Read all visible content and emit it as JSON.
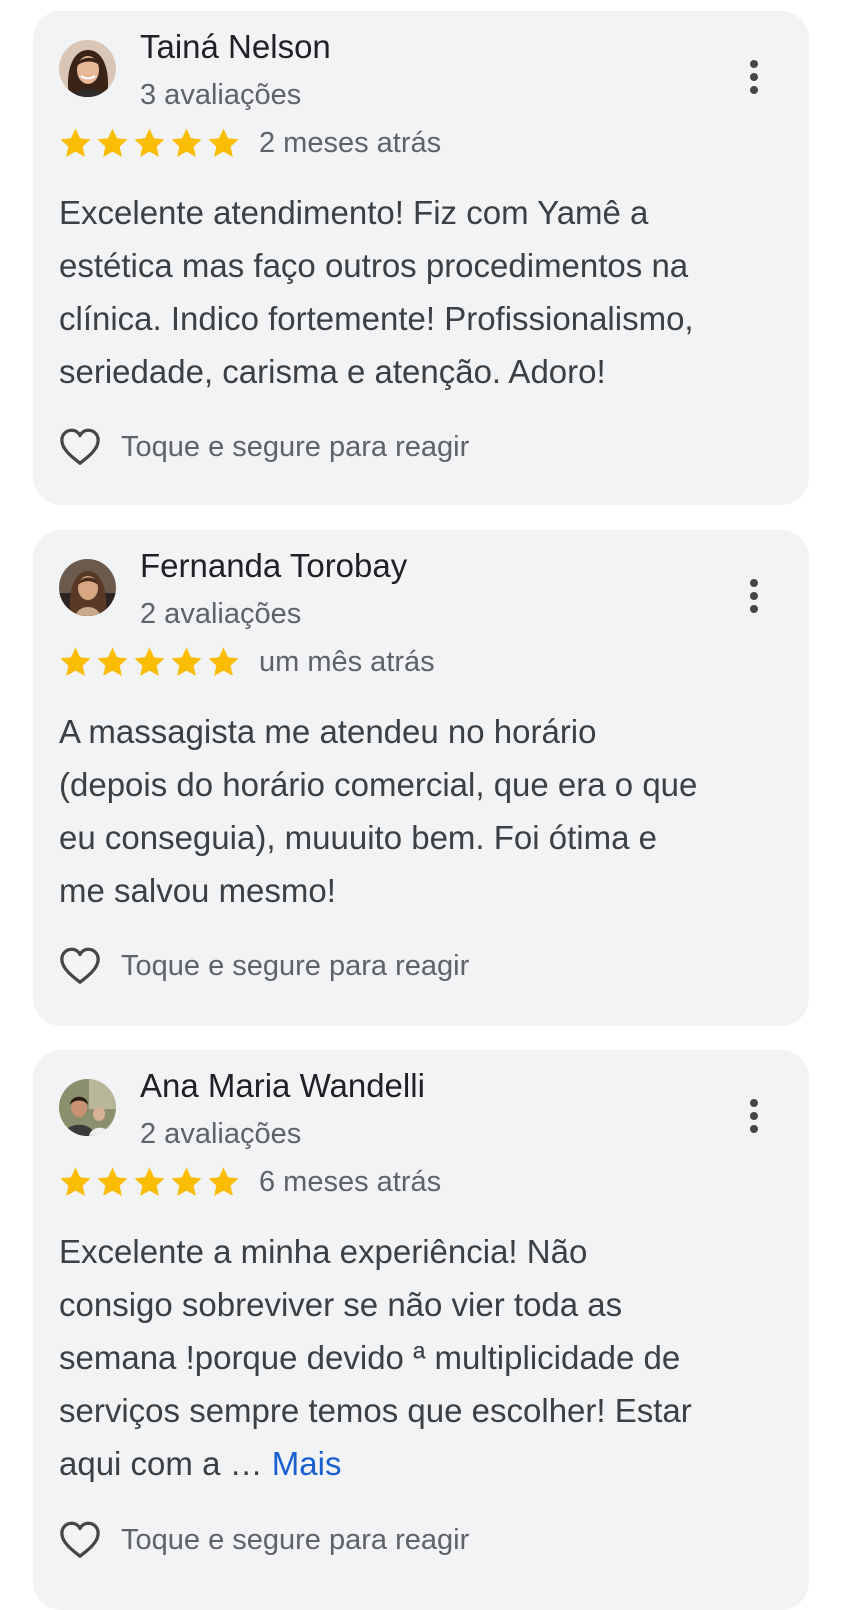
{
  "colors": {
    "card_background": "#f2f3f5",
    "star": "#fbbc04",
    "link": "#1a5fd0",
    "secondary_text": "#5f6368"
  },
  "reviews": [
    {
      "name": "Tainá Nelson",
      "count": "3 avaliações",
      "rating": 5,
      "time": "2 meses atrás",
      "text": "Excelente atendimento! Fiz com Yamê a\nestética mas faço outros procedimentos na\nclínica. Indico fortemente! Profissionalismo,\nseriedade, carisma e atenção. Adoro!",
      "react_label": "Toque e segure para reagir"
    },
    {
      "name": "Fernanda Torobay",
      "count": "2 avaliações",
      "rating": 5,
      "time": "um mês atrás",
      "text": "A massagista me atendeu no horário\n(depois do horário comercial, que era o que\neu conseguia), muuuito bem. Foi ótima e\nme salvou mesmo!",
      "react_label": "Toque e segure para reagir"
    },
    {
      "name": "Ana Maria Wandelli",
      "count": "2 avaliações",
      "rating": 5,
      "time": "6 meses atrás",
      "text": "Excelente a minha experiência! Não\nconsigo sobreviver se não vier toda as\nsemana !porque devido ª multiplicidade de\nserviços sempre temos que escolher! Estar\naqui com a …",
      "more_label": "Mais",
      "react_label": "Toque e segure para reagir"
    }
  ]
}
